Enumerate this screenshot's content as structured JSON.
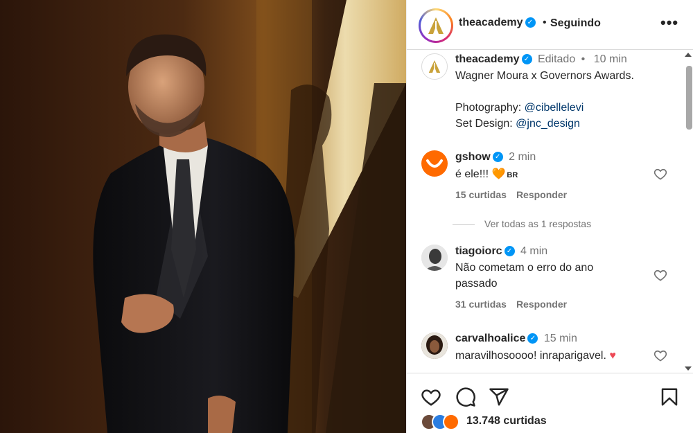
{
  "post": {
    "author": "theacademy",
    "follow_status": "Seguindo",
    "more_icon": "more-horizontal-icon",
    "caption": {
      "username": "theacademy",
      "edited_label": "Editado",
      "time": "10 min",
      "text": "Wagner Moura x Governors Awards.",
      "photography_label": "Photography:",
      "photography_link": "@cibellelevi",
      "set_design_label": "Set Design:",
      "set_design_link": "@jnc_design"
    },
    "comments": [
      {
        "username": "gshow",
        "time": "2 min",
        "text": "é ele!!!",
        "emoji": "🧡",
        "flag": "BR",
        "likes": "15 curtidas",
        "reply": "Responder"
      },
      {
        "username": "tiagoiorc",
        "time": "4 min",
        "text": "Não cometam o erro do ano passado",
        "likes": "31 curtidas",
        "reply": "Responder"
      },
      {
        "username": "carvalhoalice",
        "time": "15 min",
        "text": "maravilhosoooo! inraparigavel.",
        "emoji": "♥"
      }
    ],
    "view_replies": "Ver todas as 1 respostas",
    "footer": {
      "likes_count": "13.748 curtidas",
      "icons": [
        "heart-icon",
        "comment-icon",
        "share-icon",
        "bookmark-icon"
      ]
    }
  },
  "colors": {
    "verified": "#0095f6",
    "link": "#00376b",
    "secondary_text": "#737373",
    "gshow_orange": "#ff6a00",
    "heart_red": "#ed4956"
  }
}
